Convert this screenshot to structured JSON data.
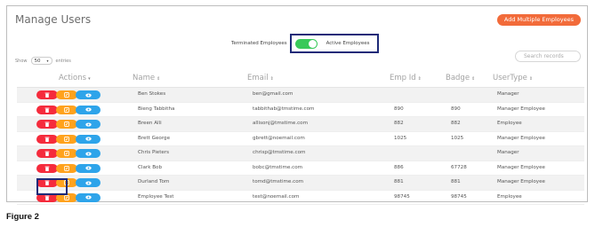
{
  "page": {
    "title": "Manage Users",
    "add_button": "Add Multiple Employees",
    "toggle": {
      "left_label": "Terminated Employees",
      "right_label": "Active Employees",
      "state": "on"
    },
    "show": {
      "prefix": "Show",
      "value": "50",
      "suffix": "entries"
    },
    "search_placeholder": "Search records",
    "figure_caption": "Figure 2"
  },
  "table": {
    "columns": [
      {
        "label": "Actions",
        "sort": "▾"
      },
      {
        "label": "Name",
        "sort": "⇕"
      },
      {
        "label": "Email",
        "sort": "⇕"
      },
      {
        "label": "Emp Id",
        "sort": "⇕"
      },
      {
        "label": "Badge",
        "sort": "⇕"
      },
      {
        "label": "UserType",
        "sort": "⇕"
      }
    ],
    "rows": [
      {
        "name": "Ben Stokes",
        "email": "ben@gmail.com",
        "emp_id": "",
        "badge": "",
        "type": "Manager"
      },
      {
        "name": "Bieng Tabbitha",
        "email": "tabbithab@tmstime.com",
        "emp_id": "890",
        "badge": "890",
        "type": "Manager Employee"
      },
      {
        "name": "Breen Alli",
        "email": "allisonj@tmstime.com",
        "emp_id": "882",
        "badge": "882",
        "type": "Employee"
      },
      {
        "name": "Brett George",
        "email": "gbrett@noemail.com",
        "emp_id": "1025",
        "badge": "1025",
        "type": "Manager Employee"
      },
      {
        "name": "Chris Pieters",
        "email": "chrisp@tmstime.com",
        "emp_id": "",
        "badge": "",
        "type": "Manager"
      },
      {
        "name": "Clark Bob",
        "email": "bobc@tmstime.com",
        "emp_id": "886",
        "badge": "67728",
        "type": "Manager Employee"
      },
      {
        "name": "Durland Tom",
        "email": "tomd@tmstime.com",
        "emp_id": "881",
        "badge": "881",
        "type": "Manager Employee"
      },
      {
        "name": "Employee Test",
        "email": "test@noemail.com",
        "emp_id": "98745",
        "badge": "98745",
        "type": "Employee"
      }
    ]
  },
  "colors": {
    "delete": "#f52b3c",
    "edit": "#ffa21c",
    "view": "#2ea4ea",
    "accent": "#f26b3a",
    "toggle_on": "#38c95a",
    "highlight": "#1e2a78"
  },
  "icons": {
    "delete": "trash-icon",
    "edit": "pencil-icon",
    "view": "eye-icon"
  }
}
